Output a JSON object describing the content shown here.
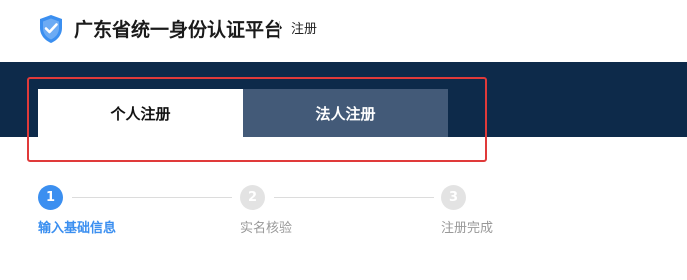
{
  "header": {
    "title": "广东省统一身份认证平台",
    "subtitle": "注册",
    "logo_icon": "shield-check-icon"
  },
  "tabs": [
    {
      "label": "个人注册",
      "active": true
    },
    {
      "label": "法人注册",
      "active": false
    }
  ],
  "steps": [
    {
      "number": "1",
      "label": "输入基础信息",
      "active": true
    },
    {
      "number": "2",
      "label": "实名核验",
      "active": false
    },
    {
      "number": "3",
      "label": "注册完成",
      "active": false
    }
  ],
  "colors": {
    "banner": "#0d2a4a",
    "tab_inactive": "#435a78",
    "accent": "#3b8ff0",
    "highlight": "#e03a3a",
    "inactive_step": "#e3e3e3"
  }
}
